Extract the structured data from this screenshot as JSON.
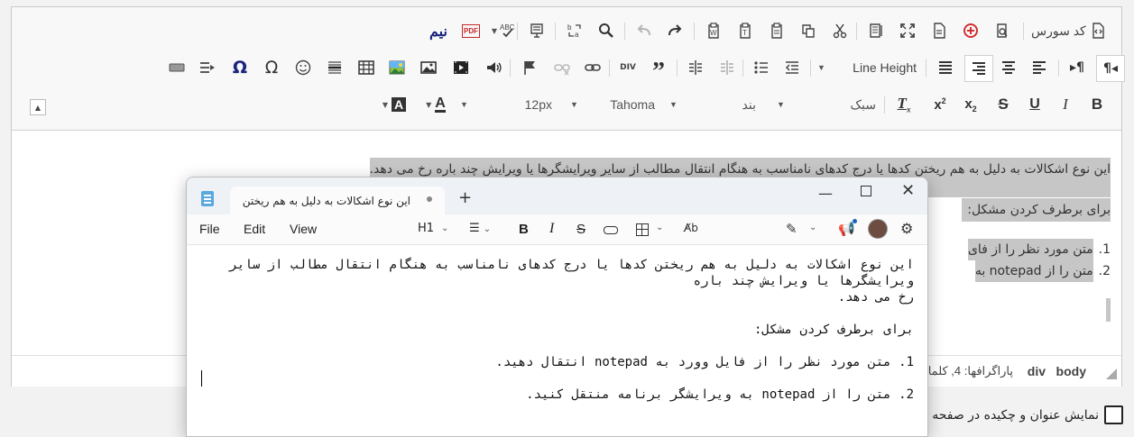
{
  "toolbar": {
    "source_label": "کد سورس",
    "pdf_label": "PDF",
    "nim_label": "نیم",
    "line_height_label": "Line Height",
    "style_combo": "سبک",
    "format_combo": "بند",
    "font_combo": "Tahoma",
    "size_combo": "12px",
    "bold_icon": "B",
    "italic_icon": "I",
    "underline_icon": "U",
    "strike_icon": "S"
  },
  "content": {
    "line1": "این نوع اشکالات به دلیل به هم ریختن کدها یا درج کدهای نامناسب به هنگام انتقال مطالب از سایر ویرایشگرها یا ویرایش چند باره رخ می دهد.",
    "heading": "برای برطرف کردن مشکل:",
    "item1_visible": "متن مورد نظر را از فای",
    "item2_visible": "متن را از notepad به",
    "item1_num": "1.",
    "item2_num": "2."
  },
  "status": {
    "body": "body",
    "div": "div",
    "para_info": "پاراگرافها: 4, کلما"
  },
  "checkbox": {
    "label": "نمایش عنوان و چکیده در صفحه"
  },
  "notepad": {
    "tab_title": "این نوع اشکالات به دلیل به هم ریختن",
    "menu": [
      "File",
      "Edit",
      "View"
    ],
    "heading_select": "H1",
    "text_line1": "این نوع اشکالات به دلیل به هم ریختن کدها یا درج کدهای نامناسب به هنگام انتقال مطالب از سایر ویرایشگرها یا ویرایش چند باره",
    "text_line2": "رخ می دهد.",
    "text_line3": "برای برطرف کردن مشکل:",
    "text_item1": "1. متن مورد نظر را از فایل وورد به notepad  انتقال دهید.",
    "text_item2": "2. متن را از notepad به ویرایشگر برنامه منتقل کنید."
  }
}
